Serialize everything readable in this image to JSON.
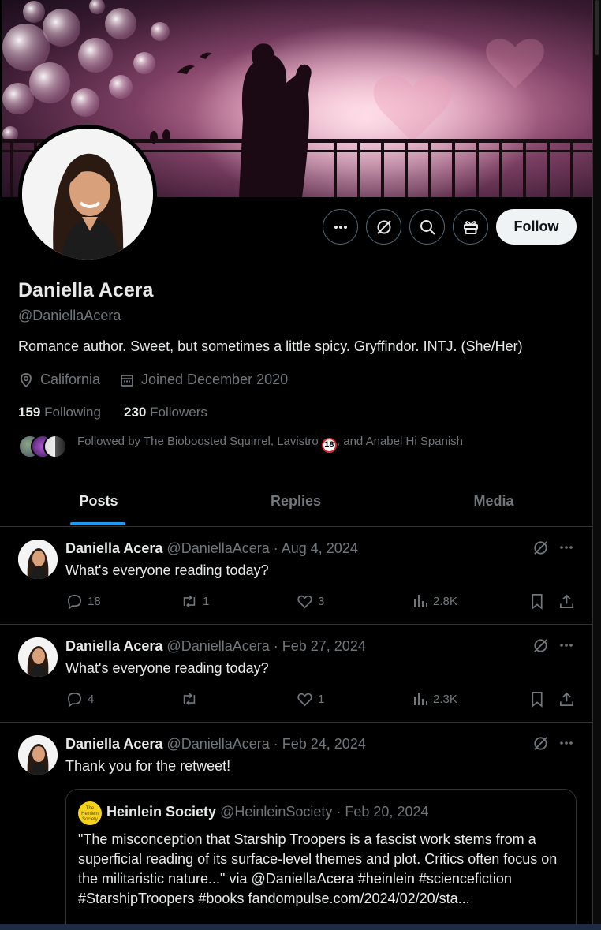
{
  "profile": {
    "name": "Daniella Acera",
    "handle": "@DaniellaAcera",
    "bio": "Romance author. Sweet, but sometimes a little spicy. Gryffindor. INTJ. (She/Her)",
    "location": "California",
    "joined": "Joined December 2020",
    "following_count": "159",
    "following_label": "Following",
    "followers_count": "230",
    "followers_label": "Followers",
    "followed_by_prefix": "Followed by The Bioboosted Squirrel, Lavistro",
    "followed_by_badge": "18",
    "followed_by_suffix": ", and Anabel Hi Spanish"
  },
  "actions": {
    "more_icon": "more-icon",
    "grok_icon": "grok-icon",
    "search_icon": "search-icon",
    "gift_icon": "gift-icon",
    "follow_label": "Follow"
  },
  "tabs": [
    {
      "label": "Posts",
      "active": true
    },
    {
      "label": "Replies",
      "active": false
    },
    {
      "label": "Media",
      "active": false
    }
  ],
  "posts": [
    {
      "name": "Daniella Acera",
      "handle_date": "@DaniellaAcera · Aug 4, 2024",
      "text": "What's everyone reading today?",
      "replies": "18",
      "reposts": "1",
      "likes": "3",
      "views": "2.8K"
    },
    {
      "name": "Daniella Acera",
      "handle_date": "@DaniellaAcera · Feb 27, 2024",
      "text": "What's everyone reading today?",
      "replies": "4",
      "reposts": "",
      "likes": "1",
      "views": "2.3K"
    },
    {
      "name": "Daniella Acera",
      "handle_date": "@DaniellaAcera · Feb 24, 2024",
      "text": "Thank you for the retweet!",
      "quote": {
        "avatar_text": "The Heinlein Society",
        "name": "Heinlein Society",
        "handle_date": "@HeinleinSociety · Feb 20, 2024",
        "text": "\"The misconception that Starship Troopers is a fascist work stems from a superficial reading of its surface-level themes and plot. Critics often focus on the militaristic nature...\" via @DaniellaAcera #heinlein #sciencefiction #StarshipTroopers #books fandompulse.com/2024/02/20/sta..."
      }
    }
  ],
  "colors": {
    "background": "#000000",
    "text": "#e7e9ea",
    "muted": "#71767b",
    "accent": "#1d9bf0",
    "border": "#2f3336"
  }
}
